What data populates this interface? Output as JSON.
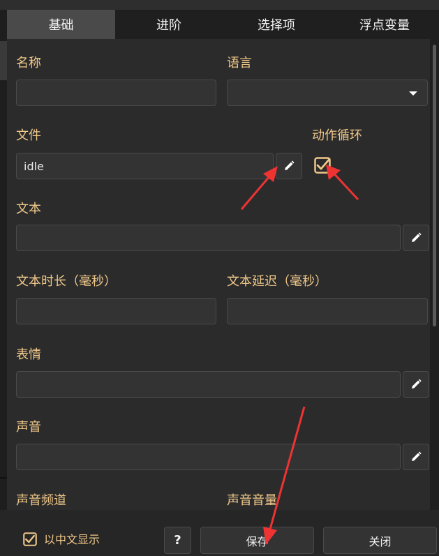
{
  "tabs": [
    "基础",
    "进阶",
    "选择项",
    "浮点变量"
  ],
  "fields": {
    "name_label": "名称",
    "language_label": "语言",
    "file_label": "文件",
    "file_value": "idle",
    "loop_label": "动作循环",
    "loop_checked": true,
    "text_label": "文本",
    "text_duration_label": "文本时长（毫秒）",
    "text_delay_label": "文本延迟（毫秒）",
    "expression_label": "表情",
    "sound_label": "声音",
    "sound_channel_label": "声音频道",
    "sound_volume_label": "声音音量"
  },
  "bottom": {
    "chinese_display_label": "以中文显示",
    "chinese_display_checked": true,
    "help_label": "?",
    "save_label": "保存",
    "close_label": "关闭"
  },
  "colors": {
    "label": "#f0c88a",
    "annotation_arrow": "#ee3333"
  },
  "icons": [
    "pencil-icon",
    "checkbox-checked-icon",
    "dropdown-caret-icon"
  ]
}
